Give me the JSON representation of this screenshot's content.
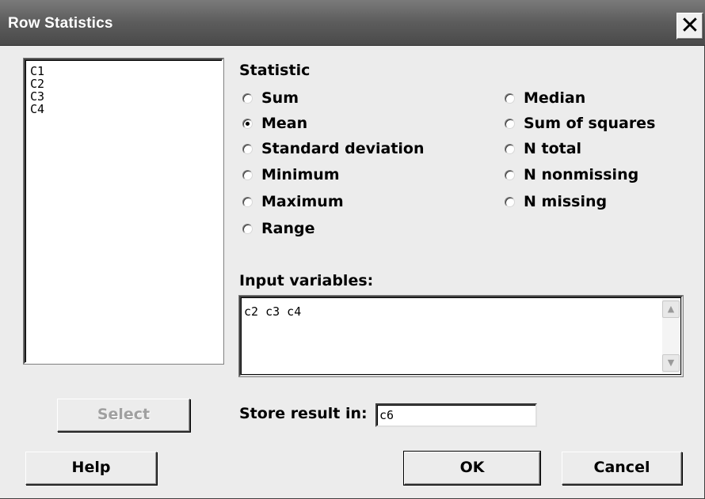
{
  "window": {
    "title": "Row Statistics",
    "close_glyph": "✕"
  },
  "variables_list": [
    "C1",
    "C2",
    "C3",
    "C4"
  ],
  "statistic": {
    "heading": "Statistic",
    "options": [
      {
        "label": "Sum",
        "checked": false
      },
      {
        "label": "Mean",
        "checked": true
      },
      {
        "label": "Standard deviation",
        "checked": false
      },
      {
        "label": "Minimum",
        "checked": false
      },
      {
        "label": "Maximum",
        "checked": false
      },
      {
        "label": "Range",
        "checked": false
      },
      {
        "label": "Median",
        "checked": false
      },
      {
        "label": "Sum of squares",
        "checked": false
      },
      {
        "label": "N total",
        "checked": false
      },
      {
        "label": "N nonmissing",
        "checked": false
      },
      {
        "label": "N missing",
        "checked": false
      }
    ]
  },
  "input_variables": {
    "label": "Input variables:",
    "value": "c2 c3 c4"
  },
  "store_result": {
    "label": "Store result in:",
    "value": "c6"
  },
  "buttons": {
    "select": "Select",
    "help": "Help",
    "ok": "OK",
    "cancel": "Cancel"
  },
  "icons": {
    "scroll_up": "▲",
    "scroll_down": "▼"
  }
}
